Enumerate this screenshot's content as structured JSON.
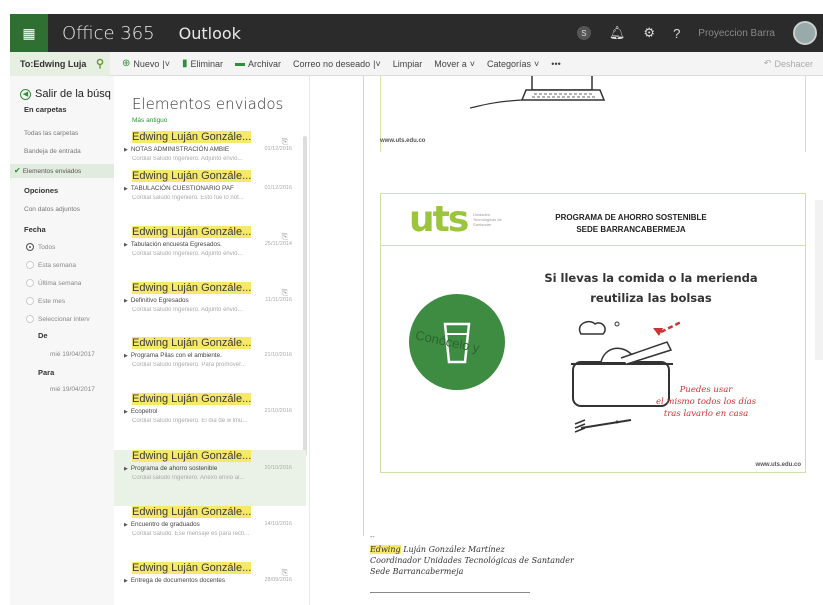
{
  "topbar": {
    "brand": "Office 365",
    "app": "Outlook",
    "badge": "S",
    "help": "?",
    "user_name": "Proyeccion Barra"
  },
  "commandbar": {
    "search_scope": "To:Edwing Luja",
    "new_label": "Nuevo",
    "delete_label": "Eliminar",
    "archive_label": "Archivar",
    "junk_label": "Correo no deseado",
    "sweep_label": "Limpiar",
    "move_label": "Mover a",
    "categories_label": "Categorías",
    "more_label": "•••",
    "undo_label": "Deshacer"
  },
  "leftnav": {
    "exit_label": "Salir de la búsq",
    "in_folders": "En carpetas",
    "folders": [
      {
        "label": "Todas las carpetas",
        "selected": false
      },
      {
        "label": "Bandeja de entrada",
        "selected": false
      },
      {
        "label": "Elementos enviados",
        "selected": true
      }
    ],
    "options_heading": "Opciones",
    "with_attachments": "Con datos adjuntos",
    "date_heading": "Fecha",
    "date_options": [
      {
        "label": "Todos",
        "checked": true
      },
      {
        "label": "Esta semana",
        "checked": false
      },
      {
        "label": "Última semana",
        "checked": false
      },
      {
        "label": "Este mes",
        "checked": false
      },
      {
        "label": "Seleccionar interv",
        "checked": false
      }
    ],
    "from_label": "De",
    "from_value": "mié 19/04/2017",
    "to_label": "Para",
    "to_value": "mié 19/04/2017"
  },
  "messagelist": {
    "title": "Elementos enviados",
    "sort_label": "Más antiguo",
    "messages": [
      {
        "sender": "Edwing Luján Gonzále...",
        "subject": "NOTAS ADMINISTRACIÓN AMBIE",
        "date": "01/12/2016",
        "preview": "Cordial Saludo Ingeniero.  Adjunto envió...",
        "attachment": true,
        "selected": false
      },
      {
        "sender": "Edwing Luján Gonzále...",
        "subject": "TABULACIÓN CUESTIONARIO PAF",
        "date": "01/12/2016",
        "preview": "Cordial saludo Ingeniero.  Esto fue lo not...",
        "attachment": false,
        "selected": false
      },
      {
        "sender": "Edwing Luján Gonzále...",
        "subject": "Tabulación encuesta Egresados.",
        "date": "25/11/2014",
        "preview": "Cordial Saludo Ingeniero.  Adjunto envió...",
        "attachment": true,
        "selected": false
      },
      {
        "sender": "Edwing Luján Gonzále...",
        "subject": "Definitivo Egresados",
        "date": "11/11/2016",
        "preview": "Cordial Saludo Ingeniero.  Adjunto envió...",
        "attachment": true,
        "selected": false
      },
      {
        "sender": "Edwing Luján Gonzále...",
        "subject": "Programa Pilas con el ambiente.",
        "date": "21/10/2016",
        "preview": "Cordial Saludo Ingeniero.  Para promover...",
        "attachment": false,
        "selected": false
      },
      {
        "sender": "Edwing Luján Gonzále...",
        "subject": "Ecopetrol",
        "date": "21/10/2016",
        "preview": "Cordial Saludo Ingeniero.  El día de w lmu...",
        "attachment": false,
        "selected": false
      },
      {
        "sender": "Edwing Luján Gonzále...",
        "subject": "Programa de ahorro sostenible",
        "date": "20/10/2016",
        "preview": "Cordial saludo Ingeniero.  Anexo envió al...",
        "attachment": false,
        "selected": true
      },
      {
        "sender": "Edwing Luján Gonzále...",
        "subject": "Encuentro de graduados",
        "date": "14/10/2016",
        "preview": "Cordial Saludo.  Ese mensaje es para recti...",
        "attachment": false,
        "selected": false
      },
      {
        "sender": "Edwing Luján Gonzále...",
        "subject": "Entrega de documentos docentes",
        "date": "28/09/2016",
        "preview": "",
        "attachment": true,
        "selected": false
      }
    ]
  },
  "reading": {
    "web_label_top": "www.uts.edu.co",
    "web_label_bottom": "www.uts.edu.co",
    "logo": "uts",
    "logo_small": "Unidades Tecnológicas de Santander",
    "program_line1": "PROGRAMA DE AHORRO SOSTENIBLE",
    "program_line2": "SEDE BARRANCABERMEJA",
    "headline_line1": "Si llevas la comida o la merienda",
    "headline_line2": "reutiliza las bolsas",
    "circle_text": "Conócelo y",
    "tip_line1": "Puedes usar",
    "tip_line2": "el mismo todos los días",
    "tip_line3": "tras lavarlo en casa",
    "signature_dash": "--",
    "sig_first": "Edwing",
    "sig_rest": "Luján González Martínez",
    "sig_role": "Coordinador Unidades Tecnológicas de Santander",
    "sig_site": "Sede Barrancabermeja"
  },
  "colors": {
    "accent_green": "#2f8f3a",
    "topbar_bg": "#2b2b2b",
    "highlight": "#f6e96a",
    "uts_green": "#9bc53d"
  }
}
